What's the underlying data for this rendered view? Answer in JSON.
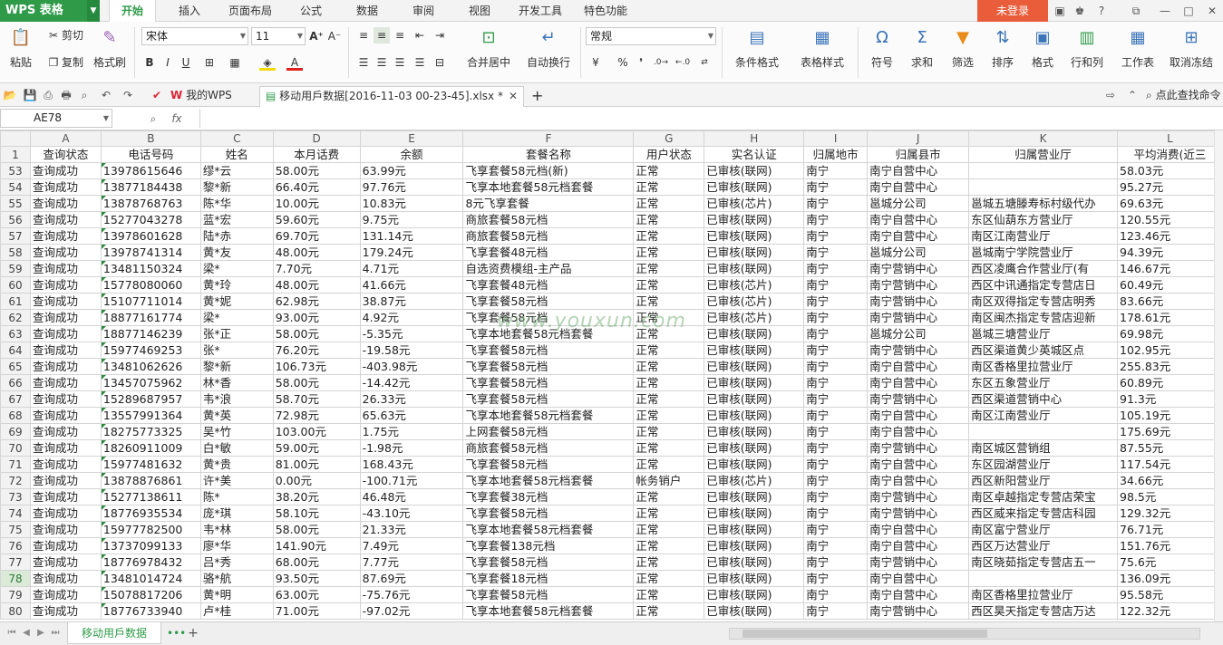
{
  "app": {
    "logo": "WPS 表格"
  },
  "menu": {
    "items": [
      "开始",
      "插入",
      "页面布局",
      "公式",
      "数据",
      "审阅",
      "视图",
      "开发工具",
      "特色功能"
    ],
    "active": "开始",
    "login": "未登录"
  },
  "ribbon": {
    "paste": "粘贴",
    "cut": "剪切",
    "copy": "复制",
    "format_painter": "格式刷",
    "font_name": "宋体",
    "font_size": "11",
    "merge_center": "合并居中",
    "wrap_text": "自动换行",
    "number_format": "常规",
    "percent": "%",
    "comma": "❜",
    "cond_format": "条件格式",
    "table_style": "表格样式",
    "symbol": "符号",
    "sum": "求和",
    "filter": "筛选",
    "sort": "排序",
    "format": "格式",
    "row_col": "行和列",
    "worksheet": "工作表",
    "freeze": "取消冻结"
  },
  "doc_tabs": {
    "mywps": "我的WPS",
    "file": "移动用戶数据[2016-11-03 00-23-45].xlsx *",
    "search": "点此查找命令"
  },
  "formula_bar": {
    "name_box": "AE78",
    "fx": "fx",
    "content": ""
  },
  "grid": {
    "columns": [
      "A",
      "B",
      "C",
      "D",
      "E",
      "F",
      "G",
      "H",
      "I",
      "J",
      "K",
      "L"
    ],
    "header_row_num": "1",
    "headers": [
      "查询状态",
      "电话号码",
      "姓名",
      "本月话费",
      "余额",
      "套餐名称",
      "用户状态",
      "实名认证",
      "归属地市",
      "归属县市",
      "归属营业厅",
      "平均消费(近三"
    ],
    "selected_row": "78",
    "rows": [
      [
        "53",
        "查询成功",
        "13978615646",
        "缪*云",
        "58.00元",
        "63.99元",
        "飞享套餐58元档(新)",
        "正常",
        "已审核(联网)",
        "南宁",
        "南宁自营中心",
        "",
        "58.03元"
      ],
      [
        "54",
        "查询成功",
        "13877184438",
        "黎*新",
        "66.40元",
        "97.76元",
        "飞享本地套餐58元档套餐",
        "正常",
        "已审核(联网)",
        "南宁",
        "南宁自营中心",
        "",
        "95.27元"
      ],
      [
        "55",
        "查询成功",
        "13878768763",
        "陈*华",
        "10.00元",
        "10.83元",
        "8元飞享套餐",
        "正常",
        "已审核(芯片)",
        "南宁",
        "邕城分公司",
        "邕城五塘滕寿标村级代办",
        "69.63元"
      ],
      [
        "56",
        "查询成功",
        "15277043278",
        "蓝*宏",
        "59.60元",
        "9.75元",
        "商旅套餐58元档",
        "正常",
        "已审核(联网)",
        "南宁",
        "南宁自营中心",
        "东区仙葫东方营业厅",
        "120.55元"
      ],
      [
        "57",
        "查询成功",
        "13978601628",
        "陆*赤",
        "69.70元",
        "131.14元",
        "商旅套餐58元档",
        "正常",
        "已审核(联网)",
        "南宁",
        "南宁自营中心",
        "南区江南营业厅",
        "123.46元"
      ],
      [
        "58",
        "查询成功",
        "13978741314",
        "黄*友",
        "48.00元",
        "179.24元",
        "飞享套餐48元档",
        "正常",
        "已审核(联网)",
        "南宁",
        "邕城分公司",
        "邕城南宁学院营业厅",
        "94.39元"
      ],
      [
        "59",
        "查询成功",
        "13481150324",
        "梁*",
        "7.70元",
        "4.71元",
        "自选资费模组-主产品",
        "正常",
        "已审核(联网)",
        "南宁",
        "南宁营销中心",
        "西区凌鹰合作营业厅(有",
        "146.67元"
      ],
      [
        "60",
        "查询成功",
        "15778080060",
        "黄*玲",
        "48.00元",
        "41.66元",
        "飞享套餐48元档",
        "正常",
        "已审核(芯片)",
        "南宁",
        "南宁营销中心",
        "西区中讯通指定专营店日",
        "60.49元"
      ],
      [
        "61",
        "查询成功",
        "15107711014",
        "黄*妮",
        "62.98元",
        "38.87元",
        "飞享套餐58元档",
        "正常",
        "已审核(芯片)",
        "南宁",
        "南宁营销中心",
        "南区双得指定专营店明秀",
        "83.66元"
      ],
      [
        "62",
        "查询成功",
        "18877161774",
        "梁*",
        "93.00元",
        "4.92元",
        "飞享套餐58元档",
        "正常",
        "已审核(芯片)",
        "南宁",
        "南宁营销中心",
        "南区闽杰指定专营店迎新",
        "178.61元"
      ],
      [
        "63",
        "查询成功",
        "18877146239",
        "张*正",
        "58.00元",
        "-5.35元",
        "飞享本地套餐58元档套餐",
        "正常",
        "已审核(联网)",
        "南宁",
        "邕城分公司",
        "邕城三塘营业厅",
        "69.98元"
      ],
      [
        "64",
        "查询成功",
        "15977469253",
        "张*",
        "76.20元",
        "-19.58元",
        "飞享套餐58元档",
        "正常",
        "已审核(联网)",
        "南宁",
        "南宁营销中心",
        "西区渠道黄少英城区点",
        "102.95元"
      ],
      [
        "65",
        "查询成功",
        "13481062626",
        "黎*新",
        "106.73元",
        "-403.98元",
        "飞享套餐58元档",
        "正常",
        "已审核(联网)",
        "南宁",
        "南宁自营中心",
        "南区香格里拉营业厅",
        "255.83元"
      ],
      [
        "66",
        "查询成功",
        "13457075962",
        "林*香",
        "58.00元",
        "-14.42元",
        "飞享套餐58元档",
        "正常",
        "已审核(联网)",
        "南宁",
        "南宁自营中心",
        "东区五象营业厅",
        "60.89元"
      ],
      [
        "67",
        "查询成功",
        "15289687957",
        "韦*浪",
        "58.70元",
        "26.33元",
        "飞享套餐58元档",
        "正常",
        "已审核(联网)",
        "南宁",
        "南宁营销中心",
        "西区渠道营销中心",
        "91.3元"
      ],
      [
        "68",
        "查询成功",
        "13557991364",
        "黄*英",
        "72.98元",
        "65.63元",
        "飞享本地套餐58元档套餐",
        "正常",
        "已审核(联网)",
        "南宁",
        "南宁自营中心",
        "南区江南营业厅",
        "105.19元"
      ],
      [
        "69",
        "查询成功",
        "18275773325",
        "吴*竹",
        "103.00元",
        "1.75元",
        "上网套餐58元档",
        "正常",
        "已审核(联网)",
        "南宁",
        "南宁自营中心",
        "",
        "175.69元"
      ],
      [
        "70",
        "查询成功",
        "18260911009",
        "白*敏",
        "59.00元",
        "-1.98元",
        "商旅套餐58元档",
        "正常",
        "已审核(联网)",
        "南宁",
        "南宁营销中心",
        "南区城区营销组",
        "87.55元"
      ],
      [
        "71",
        "查询成功",
        "15977481632",
        "黄*贵",
        "81.00元",
        "168.43元",
        "飞享套餐58元档",
        "正常",
        "已审核(联网)",
        "南宁",
        "南宁自营中心",
        "东区园湖营业厅",
        "117.54元"
      ],
      [
        "72",
        "查询成功",
        "13878876861",
        "许*美",
        "0.00元",
        "-100.71元",
        "飞享本地套餐58元档套餐",
        "帐务销户",
        "已审核(芯片)",
        "南宁",
        "南宁自营中心",
        "西区新阳营业厅",
        "34.66元"
      ],
      [
        "73",
        "查询成功",
        "15277138611",
        "陈*",
        "38.20元",
        "46.48元",
        "飞享套餐38元档",
        "正常",
        "已审核(联网)",
        "南宁",
        "南宁营销中心",
        "南区卓越指定专营店荣宝",
        "98.5元"
      ],
      [
        "74",
        "查询成功",
        "18776935534",
        "庞*琪",
        "58.10元",
        "-43.10元",
        "飞享套餐58元档",
        "正常",
        "已审核(联网)",
        "南宁",
        "南宁营销中心",
        "西区威来指定专营店科园",
        "129.32元"
      ],
      [
        "75",
        "查询成功",
        "15977782500",
        "韦*林",
        "58.00元",
        "21.33元",
        "飞享本地套餐58元档套餐",
        "正常",
        "已审核(联网)",
        "南宁",
        "南宁自营中心",
        "南区富宁营业厅",
        "76.71元"
      ],
      [
        "76",
        "查询成功",
        "13737099133",
        "廖*华",
        "141.90元",
        "7.49元",
        "飞享套餐138元档",
        "正常",
        "已审核(联网)",
        "南宁",
        "南宁自营中心",
        "西区万达营业厅",
        "151.76元"
      ],
      [
        "77",
        "查询成功",
        "18776978432",
        "吕*秀",
        "68.00元",
        "7.77元",
        "飞享套餐58元档",
        "正常",
        "已审核(联网)",
        "南宁",
        "南宁营销中心",
        "南区晓茹指定专营店五一",
        "75.6元"
      ],
      [
        "78",
        "查询成功",
        "13481014724",
        "骆*航",
        "93.50元",
        "87.69元",
        "飞享套餐18元档",
        "正常",
        "已审核(联网)",
        "南宁",
        "南宁自营中心",
        "",
        "136.09元"
      ],
      [
        "79",
        "查询成功",
        "15078817206",
        "黄*明",
        "63.00元",
        "-75.76元",
        "飞享套餐58元档",
        "正常",
        "已审核(联网)",
        "南宁",
        "南宁自营中心",
        "南区香格里拉营业厅",
        "95.58元"
      ],
      [
        "80",
        "查询成功",
        "18776733940",
        "卢*桂",
        "71.00元",
        "-97.02元",
        "飞享本地套餐58元档套餐",
        "正常",
        "已审核(联网)",
        "南宁",
        "南宁营销中心",
        "西区昊天指定专营店万达",
        "122.32元"
      ]
    ]
  },
  "watermark": "www.youxun.com",
  "sheet_tabs": {
    "active": "移动用戶数据",
    "more": "•••",
    "add": "+"
  }
}
